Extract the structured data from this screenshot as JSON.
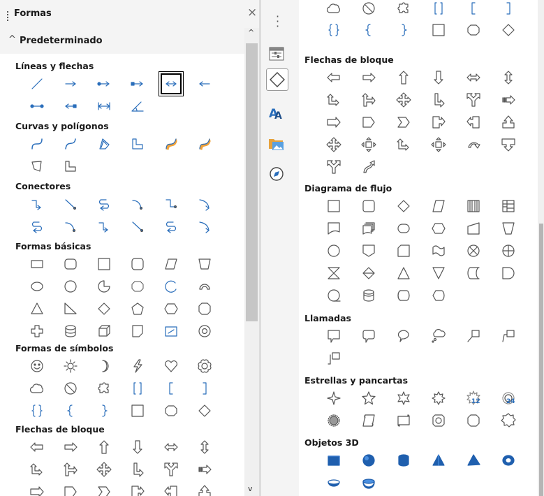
{
  "panel": {
    "title": "Formas",
    "close_icon": "×",
    "category_label": "Predeterminado",
    "category_chevron": "^"
  },
  "left_sections": [
    {
      "key": "lineas",
      "title": "Líneas y flechas"
    },
    {
      "key": "curvas",
      "title": "Curvas y polígonos"
    },
    {
      "key": "conectores",
      "title": "Conectores"
    },
    {
      "key": "basicas",
      "title": "Formas básicas"
    },
    {
      "key": "simbolos",
      "title": "Formas de símbolos"
    },
    {
      "key": "flechas",
      "title": "Flechas de bloque"
    }
  ],
  "right_sections": [
    {
      "key": "flechas",
      "title": "Flechas de bloque"
    },
    {
      "key": "flujo",
      "title": "Diagrama de flujo"
    },
    {
      "key": "llamadas",
      "title": "Llamadas"
    },
    {
      "key": "estrellas",
      "title": "Estrellas y pancartas"
    },
    {
      "key": "objetos3d",
      "title": "Objetos 3D"
    }
  ],
  "sidebar": {
    "items": [
      {
        "name": "properties-deck-icon"
      },
      {
        "name": "shapes-deck-icon",
        "active": true
      },
      {
        "name": "styles-deck-icon"
      },
      {
        "name": "gallery-deck-icon"
      },
      {
        "name": "navigator-deck-icon"
      }
    ]
  },
  "badges": {
    "star12": "12",
    "star24": "24"
  },
  "colors": {
    "shape_stroke": "#555555",
    "accent_blue": "#2a6ebb",
    "solid_blue": "#1f5fae"
  }
}
